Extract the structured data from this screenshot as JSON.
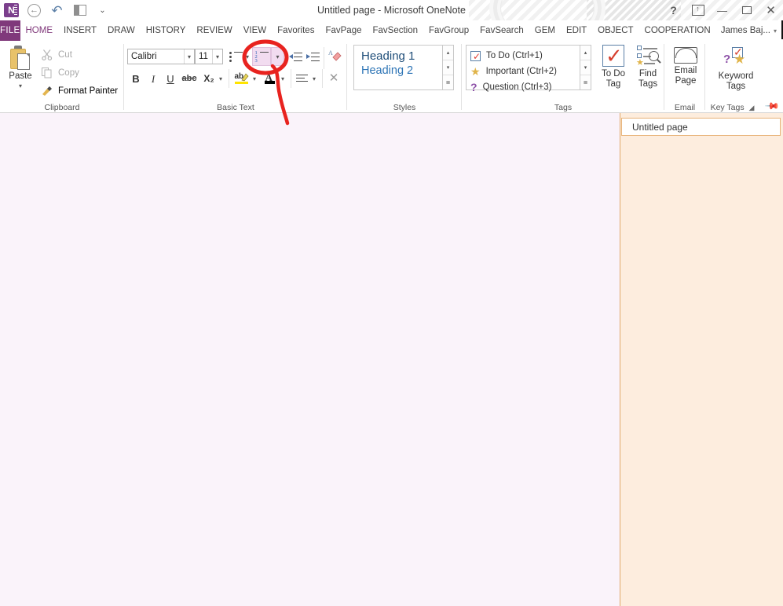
{
  "window": {
    "title": "Untitled page - Microsoft OneNote",
    "quick_access": [
      {
        "name": "onenote-logo",
        "glyph": "N"
      },
      {
        "name": "back-button",
        "glyph": "←"
      },
      {
        "name": "undo-button",
        "glyph": "↶"
      },
      {
        "name": "dock-to-desktop-button",
        "glyph": "▤"
      },
      {
        "name": "customize-quick-access-toolbar",
        "glyph": "⌄"
      }
    ],
    "controls": {
      "help": "?",
      "ribbon_display_options": "⬚",
      "minimize": "—",
      "restore": "❐",
      "close": "✕"
    }
  },
  "tabs": {
    "file": "FILE",
    "items": [
      "HOME",
      "INSERT",
      "DRAW",
      "HISTORY",
      "REVIEW",
      "VIEW",
      "Favorites",
      "FavPage",
      "FavSection",
      "FavGroup",
      "FavSearch",
      "GEM",
      "EDIT",
      "OBJECT",
      "COOPERATION"
    ],
    "active": "HOME",
    "user": "James Baj...",
    "user_caret": "▾"
  },
  "ribbon": {
    "groups": [
      "Clipboard",
      "Basic Text",
      "Styles",
      "Tags",
      "Email",
      "Key Tags"
    ],
    "clipboard": {
      "paste": {
        "label": "Paste",
        "caret": "▾"
      },
      "cut": "Cut",
      "copy": "Copy",
      "format_painter": "Format Painter"
    },
    "basic_text": {
      "font_name": "Calibri",
      "font_size": "11",
      "caret": "▾",
      "bold": "B",
      "italic": "I",
      "underline": "U",
      "strikethrough": "abc",
      "subscript": "X₂",
      "highlight_glyph": "ab",
      "highlight_color": "#ffe400",
      "font_color_glyph": "A",
      "font_color": "#000000",
      "clear_formatting": "✕",
      "bullets_title": "Bullets",
      "numbering_title": "Numbering",
      "numbering_numbers": [
        "1",
        "2",
        "3"
      ],
      "decrease_indent_title": "Decrease Indent",
      "increase_indent_title": "Increase Indent",
      "styles_eraser_title": "Clear Formatting"
    },
    "styles": {
      "items": [
        {
          "label": "Heading 1",
          "color": "#1f4e79",
          "size": "14.5px"
        },
        {
          "label": "Heading 2",
          "color": "#2e75b6",
          "size": "14px"
        }
      ],
      "scroll_up": "▴",
      "scroll_down": "▾",
      "more": "≣"
    },
    "tags": {
      "items": [
        {
          "label": "To Do (Ctrl+1)",
          "icon": "todo-checkbox-icon"
        },
        {
          "label": "Important (Ctrl+2)",
          "icon": "star-icon"
        },
        {
          "label": "Question (Ctrl+3)",
          "icon": "question-mark-icon"
        }
      ],
      "scroll_up": "▴",
      "scroll_down": "▾",
      "more": "≣",
      "to_do_tag": "To Do\nTag",
      "to_do_tag_l1": "To Do",
      "to_do_tag_l2": "Tag",
      "find_tags_l1": "Find",
      "find_tags_l2": "Tags"
    },
    "email": {
      "email_page_l1": "Email",
      "email_page_l2": "Page"
    },
    "key_tags": {
      "keyword_tags_l1": "Keyword",
      "keyword_tags_l2": "Tags",
      "launcher": "⤵",
      "pin": "—"
    }
  },
  "page": {
    "tab_title": "Untitled page"
  },
  "annotation": {
    "shape": "red-ellipse-highlight",
    "target": "numbering-dropdown-button",
    "color": "#e8231f"
  },
  "colors": {
    "accent_purple": "#80397b",
    "canvas": "#faf3fa",
    "sidebar": "#fdedde",
    "sidebar_border": "#e0a86a",
    "highlight_button": "#f2dcf0"
  }
}
